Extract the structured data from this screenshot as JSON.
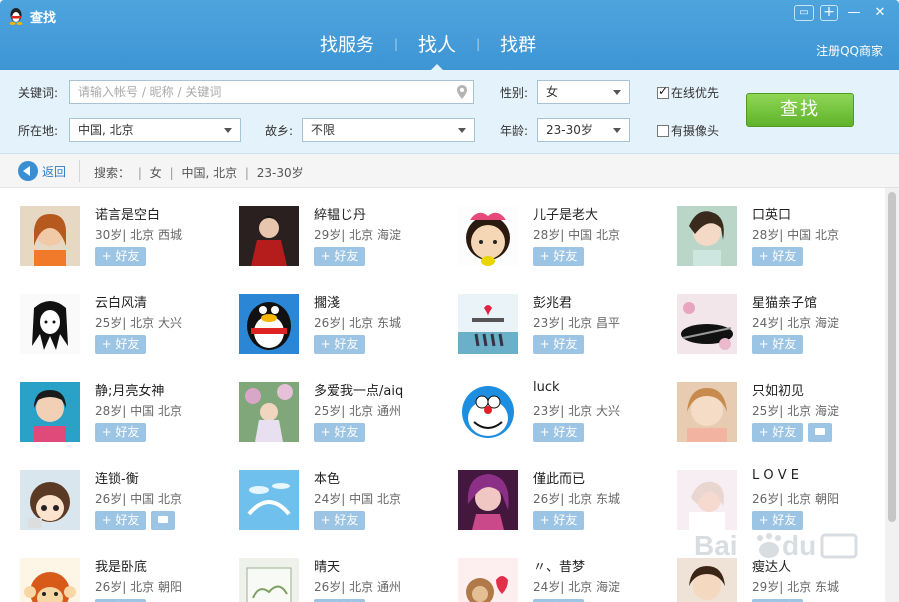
{
  "window": {
    "title": "查找",
    "controls": [
      "chat-icon",
      "add-icon",
      "minimize-icon",
      "close-icon"
    ]
  },
  "tabs": [
    {
      "label": "找服务",
      "active": false
    },
    {
      "label": "找人",
      "active": true
    },
    {
      "label": "找群",
      "active": false
    }
  ],
  "register_link": "注册QQ商家",
  "filters": {
    "keyword_label": "关键词:",
    "keyword_placeholder": "请输入帐号 / 昵称 / 关键词",
    "gender_label": "性别:",
    "gender_value": "女",
    "online_first_label": "在线优先",
    "online_first_checked": true,
    "location_label": "所在地:",
    "location_value": "中国, 北京",
    "hometown_label": "故乡:",
    "hometown_value": "不限",
    "age_label": "年龄:",
    "age_value": "23-30岁",
    "camera_label": "有摄像头",
    "camera_checked": false,
    "search_button": "查找"
  },
  "breadcrumb": {
    "back_label": "返回",
    "search_label": "搜索：",
    "items": [
      "女",
      "中国, 北京",
      "23-30岁"
    ]
  },
  "add_label": "+ 好友",
  "results": [
    {
      "nick": "诺言是空白",
      "meta": "30岁| 北京 西城",
      "message": false
    },
    {
      "nick": "綷韫じ丹",
      "meta": "29岁| 北京 海淀",
      "message": false
    },
    {
      "nick": "儿子是老大",
      "meta": "28岁| 中国 北京",
      "message": false
    },
    {
      "nick": "口英口",
      "meta": "28岁| 中国 北京",
      "message": false
    },
    {
      "nick": "云白风清",
      "meta": "25岁| 北京 大兴",
      "message": false
    },
    {
      "nick": "擱淺",
      "meta": "26岁| 北京 东城",
      "message": false
    },
    {
      "nick": "彭兆君",
      "meta": "23岁| 北京 昌平",
      "message": false
    },
    {
      "nick": "星猫亲子馆",
      "meta": "24岁| 北京 海淀",
      "message": false
    },
    {
      "nick": "静;月亮女神",
      "meta": "28岁| 中国 北京",
      "message": false
    },
    {
      "nick": "多爱我一点/aiq",
      "meta": "25岁| 北京 通州",
      "message": false
    },
    {
      "nick": "luck",
      "meta": "23岁| 北京 大兴",
      "message": false
    },
    {
      "nick": "只如初见",
      "meta": "25岁| 北京 海淀",
      "message": true
    },
    {
      "nick": "连锁-衡",
      "meta": "26岁| 中国 北京",
      "message": true
    },
    {
      "nick": "本色",
      "meta": "24岁| 中国 北京",
      "message": false
    },
    {
      "nick": "僅此而已",
      "meta": "26岁| 北京 东城",
      "message": false
    },
    {
      "nick": "L O V E",
      "meta": "26岁| 北京 朝阳",
      "message": false
    },
    {
      "nick": "我是卧底",
      "meta": "26岁| 北京 朝阳",
      "message": false
    },
    {
      "nick": "晴天",
      "meta": "26岁| 北京 通州",
      "message": false
    },
    {
      "nick": "〃、昔梦",
      "meta": "24岁| 北京 海淀",
      "message": false
    },
    {
      "nick": "瘦达人",
      "meta": "29岁| 北京 东城",
      "message": false
    }
  ],
  "colors": {
    "titlebar": "#4ea4dd",
    "panel": "#e4f2fb",
    "search_button": "#6fc236",
    "add_button": "#9cc4e4",
    "link": "#2e7bc6"
  }
}
